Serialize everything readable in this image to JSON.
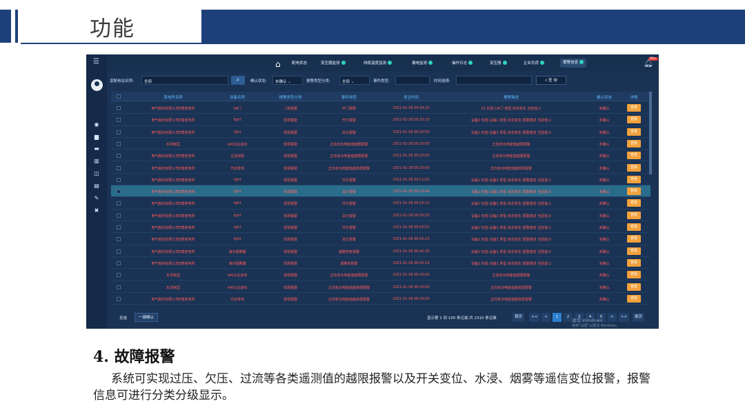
{
  "slide": {
    "title": "功能",
    "section_title": "4. 故障报警",
    "body": "系统可实现过压、欠压、过流等各类遥测值的越限报警以及开关变位、水浸、烟雾等遥信变位报警，报警信息可进行分类分级显示。"
  },
  "app": {
    "nav": [
      {
        "label": "配电状态"
      },
      {
        "label": "变压器监测"
      },
      {
        "label": "线缆温度监测"
      },
      {
        "label": "漏电监测"
      },
      {
        "label": "操作日志"
      },
      {
        "label": "变压器"
      },
      {
        "label": "企业负荷"
      },
      {
        "label": "报警信息"
      }
    ],
    "bell_badge": "99+",
    "filter": {
      "station_label": "变配电站名称:",
      "station_value": "全部",
      "confirm_label": "确认状态:",
      "confirm_value": "未确认",
      "type_label": "报警类型分类:",
      "type_value": "全部",
      "event_label": "事件类型:",
      "event_value": "",
      "time_label": "时间选择:",
      "time_value": "",
      "query_label": "查 询"
    },
    "columns": [
      "变电所名称",
      "设备名称",
      "报警类型分类",
      "事件类型",
      "发生时间",
      "报警描述",
      "确认状态",
      "详情"
    ],
    "rows": [
      [
        "电气股份有限公司E楼变电所",
        "1#门",
        "二级报警",
        "开门报警",
        "2021-01-28 09:34:25",
        "01 标签:1#门 类型:状态变化 当前值:1",
        "未确认",
        "查看"
      ],
      [
        "电气股份有限公司E楼变电所",
        "light",
        "现场报警",
        "开灯报警",
        "2021-01-28 09:33:23",
        "设备2 标签:设备2 类型:状态变化 报警描述 当前值:1",
        "未确认",
        "查看"
      ],
      [
        "电气股份有限公司E楼变电所",
        "light",
        "现场报警",
        "关灯报警",
        "2021-01-28 09:20:50",
        "设备2 标签:设备2 类型:状态变化 报警描述 当前值:0",
        "未确认",
        "查看"
      ],
      [
        "东坝家园",
        "AA01总进线",
        "现场报警",
        "正向有功电能值越限报警",
        "2021-01-28 09:20:00",
        "正向有功电能值越限报警",
        "未确认",
        "查看"
      ],
      [
        "电气股份有限公司E楼变电所",
        "主进线柜",
        "现场报警",
        "正向有功电能值越限报警",
        "2021-01-28 09:20:00",
        "正向有功电能值越限报警",
        "未确认",
        "查看"
      ],
      [
        "电气股份有限公司E楼变电所",
        "光伏发电",
        "现场报警",
        "正向有功电能值越高限报警",
        "2021-01-28 09:20:00",
        "正向有功电能值越高限报警",
        "未确认",
        "查看"
      ],
      [
        "电气股份有限公司E楼变电所",
        "light",
        "现场报警",
        "开灯报警",
        "2021-01-28 09:11:01",
        "设备2 标签:设备2 类型:状态变化 报警描述 当前值:1",
        "未确认",
        "查看"
      ],
      [
        "电气股份有限公司E楼变电所",
        "light",
        "现场报警",
        "关灯报警",
        "2021-01-28 09:10:49",
        "设备2 标签:设备2 类型:状态变化 报警描述 当前值:0",
        "未确认",
        "查看"
      ],
      [
        "电气股份有限公司E楼变电所",
        "light",
        "现场报警",
        "开灯报警",
        "2021-01-28 09:10:21",
        "设备2 标签:设备2 类型:状态变化 报警描述 当前值:1",
        "未确认",
        "查看"
      ],
      [
        "电气股份有限公司E楼变电所",
        "light",
        "现场报警",
        "关灯报警",
        "2021-01-28 08:50:55",
        "设备2 标签:设备2 类型:状态变化 报警描述 当前值:0",
        "未确认",
        "查看"
      ],
      [
        "电气股份有限公司E楼变电所",
        "light",
        "现场报警",
        "开灯报警",
        "2021-01-28 08:50:51",
        "设备2 标签:设备2 类型:状态变化 报警描述 当前值:1",
        "未确认",
        "查看"
      ],
      [
        "电气股份有限公司E楼变电所",
        "light",
        "现场报警",
        "关灯报警",
        "2021-01-28 08:50:23",
        "设备2 标签:设备2 类型:状态变化 报警描述 当前值:0",
        "未确认",
        "查看"
      ],
      [
        "电气股份有限公司E楼变电所",
        "演示烟雾器",
        "现场报警",
        "烟雾恢复报警",
        "2021-01-28 08:42:30",
        "设备2 标签:设备2 类型:状态变化 报警描述 当前值:0",
        "未确认",
        "查看"
      ],
      [
        "电气股份有限公司E楼变电所",
        "演示烟雾器",
        "现场报警",
        "烟雾有报警",
        "2021-01-28 08:42:19",
        "设备2 标签:设备2 类型:状态变化 报警描述 当前值:1",
        "未确认",
        "查看"
      ],
      [
        "东坝家园",
        "AA01总进线",
        "现场报警",
        "正向有功电能值越限报警",
        "2021-01-28 08:20:00",
        "正向有功电能值越限报警",
        "未确认",
        "查看"
      ],
      [
        "东坝家园",
        "AA01总进线",
        "现场报警",
        "正向有功电能值越高限报警",
        "2021-01-28 08:20:00",
        "正向有功电能值越高限报警",
        "未确认",
        "查看"
      ],
      [
        "电气股份有限公司E楼变电所",
        "光伏发电",
        "现场报警",
        "正向有功电能值越高限报警",
        "2021-01-28 08:20:00",
        "正向有功电能值越高限报警",
        "未确认",
        "查看"
      ]
    ],
    "selected_row": 7,
    "footer": {
      "select_all": "全选",
      "confirm_all": "一键确认",
      "summary": "显示第 1 到 100 条记录,共 2310 条记录",
      "first": "首页",
      "prev2": "<<",
      "prev": "<",
      "pages": [
        "1",
        "2",
        "3",
        "4",
        "5"
      ],
      "next": ">",
      "next2": ">>",
      "last": "尾页"
    },
    "watermark1": "激活 Windows",
    "watermark2": "转到“设置”以激活 Windows。"
  }
}
